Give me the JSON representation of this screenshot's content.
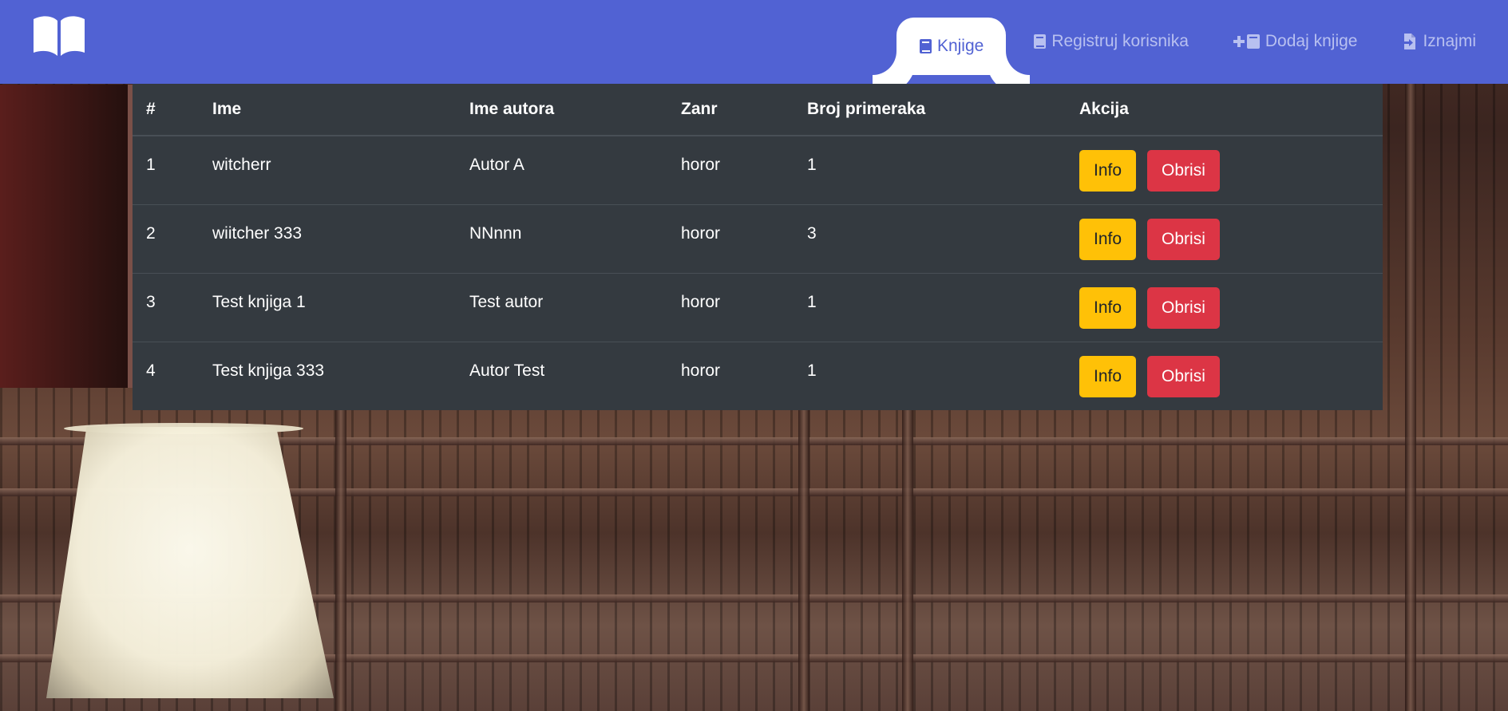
{
  "nav": {
    "brand_icon": "open-book-icon",
    "items": [
      {
        "label": "Knjige",
        "icon": "book-icon",
        "active": true
      },
      {
        "label": "Registruj korisnika",
        "icon": "book-icon",
        "active": false
      },
      {
        "label": "Dodaj knjige",
        "icon": "plus-book-icon",
        "active": false
      },
      {
        "label": "Iznajmi",
        "icon": "file-export-icon",
        "active": false
      }
    ]
  },
  "table": {
    "headers": [
      "#",
      "Ime",
      "Ime autora",
      "Zanr",
      "Broj primeraka",
      "Akcija"
    ],
    "rows": [
      {
        "num": "1",
        "ime": "witcherr",
        "autor": "Autor A",
        "zanr": "horor",
        "broj": "1",
        "info": "Info",
        "obrisi": "Obrisi"
      },
      {
        "num": "2",
        "ime": "wiitcher 333",
        "autor": "NNnnn",
        "zanr": "horor",
        "broj": "3",
        "info": "Info",
        "obrisi": "Obrisi"
      },
      {
        "num": "3",
        "ime": "Test knjiga 1",
        "autor": "Test autor",
        "zanr": "horor",
        "broj": "1",
        "info": "Info",
        "obrisi": "Obrisi"
      },
      {
        "num": "4",
        "ime": "Test knjiga 333",
        "autor": "Autor Test",
        "zanr": "horor",
        "broj": "1",
        "info": "Info",
        "obrisi": "Obrisi"
      }
    ]
  },
  "colors": {
    "navbar": "#5162d3",
    "table_bg": "#343a40",
    "info_button": "#ffc107",
    "delete_button": "#dc3545"
  }
}
